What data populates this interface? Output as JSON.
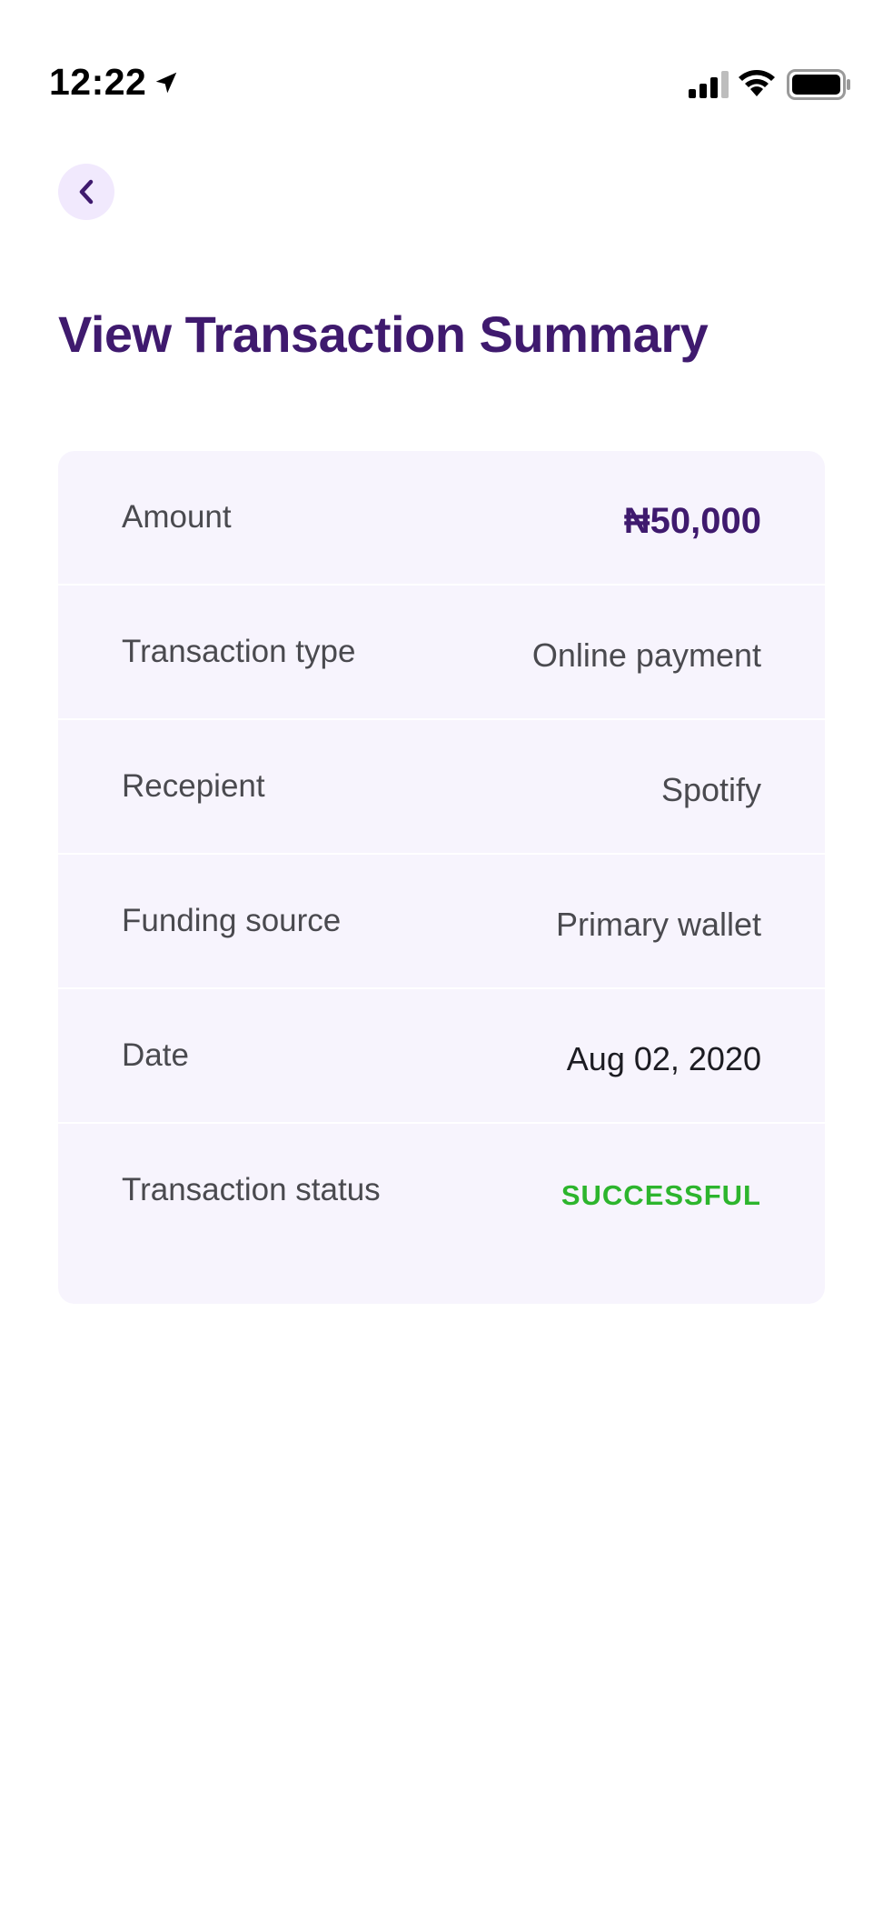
{
  "status_bar": {
    "time": "12:22",
    "icons": [
      "location-arrow-icon",
      "cellular-signal-icon",
      "wifi-icon",
      "battery-icon"
    ]
  },
  "header": {
    "back_icon": "chevron-left-icon",
    "title": "View Transaction Summary"
  },
  "summary": {
    "rows": [
      {
        "label": "Amount",
        "value": "₦50,000"
      },
      {
        "label": "Transaction type",
        "value": "Online payment"
      },
      {
        "label": "Recepient",
        "value": "Spotify"
      },
      {
        "label": "Funding source",
        "value": "Primary wallet"
      },
      {
        "label": "Date",
        "value": "Aug 02, 2020"
      },
      {
        "label": "Transaction status",
        "value": "SUCCESSFUL"
      }
    ]
  },
  "colors": {
    "brand_purple": "#3f1a6e",
    "back_button_bg": "#f1e9fd",
    "card_bg": "#f7f4fd",
    "status_success": "#2db52d",
    "text_gray": "#4a4a4f"
  }
}
